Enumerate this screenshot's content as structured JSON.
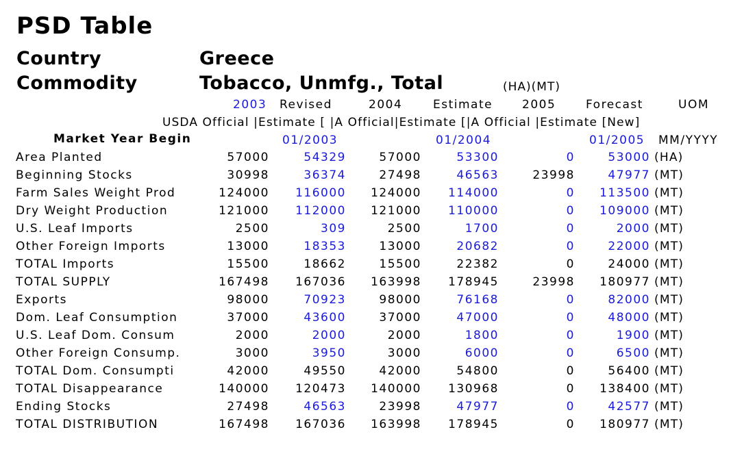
{
  "title": "PSD Table",
  "country_label": "Country",
  "country_value": "Greece",
  "commodity_label": "Commodity",
  "commodity_value": "Tobacco, Unmfg., Total",
  "units_note": "(HA)(MT)",
  "header1": [
    "2003",
    "Revised",
    "2004",
    "Estimate",
    "2005",
    "Forecast",
    "UOM"
  ],
  "header2": "USDA Official |Estimate [ |A Official|Estimate [|A Official |Estimate [New]",
  "market_year_label": "Market Year Begin",
  "market_year_values": [
    "01/2003",
    "01/2004",
    "01/2005"
  ],
  "market_year_uom": "MM/YYYY",
  "rows": [
    {
      "label": "Area Planted",
      "v": [
        "57000",
        "54329",
        "57000",
        "53300",
        "0",
        "53000"
      ],
      "uom": "(HA)"
    },
    {
      "label": "Beginning Stocks",
      "v": [
        "30998",
        "36374",
        "27498",
        "46563",
        "23998",
        "47977"
      ],
      "uom": "(MT)"
    },
    {
      "label": "Farm Sales Weight Prod",
      "v": [
        "124000",
        "116000",
        "124000",
        "114000",
        "0",
        "113500"
      ],
      "uom": "(MT)"
    },
    {
      "label": "Dry Weight Production",
      "v": [
        "121000",
        "112000",
        "121000",
        "110000",
        "0",
        "109000"
      ],
      "uom": "(MT)"
    },
    {
      "label": "U.S. Leaf Imports",
      "v": [
        "2500",
        "309",
        "2500",
        "1700",
        "0",
        "2000"
      ],
      "uom": "(MT)"
    },
    {
      "label": "Other Foreign Imports",
      "v": [
        "13000",
        "18353",
        "13000",
        "20682",
        "0",
        "22000"
      ],
      "uom": "(MT)"
    },
    {
      "label": "TOTAL Imports",
      "v": [
        "15500",
        "18662",
        "15500",
        "22382",
        "0",
        "24000"
      ],
      "uom": "(MT)"
    },
    {
      "label": "TOTAL SUPPLY",
      "v": [
        "167498",
        "167036",
        "163998",
        "178945",
        "23998",
        "180977"
      ],
      "uom": "(MT)"
    },
    {
      "label": "Exports",
      "v": [
        "98000",
        "70923",
        "98000",
        "76168",
        "0",
        "82000"
      ],
      "uom": "(MT)"
    },
    {
      "label": "Dom. Leaf Consumption",
      "v": [
        "37000",
        "43600",
        "37000",
        "47000",
        "0",
        "48000"
      ],
      "uom": "(MT)"
    },
    {
      "label": "U.S. Leaf Dom. Consum",
      "v": [
        "2000",
        "2000",
        "2000",
        "1800",
        "0",
        "1900"
      ],
      "uom": "(MT)"
    },
    {
      "label": "Other Foreign Consump.",
      "v": [
        "3000",
        "3950",
        "3000",
        "6000",
        "0",
        "6500"
      ],
      "uom": "(MT)"
    },
    {
      "label": "TOTAL Dom. Consumpti",
      "v": [
        "42000",
        "49550",
        "42000",
        "54800",
        "0",
        "56400"
      ],
      "uom": "(MT)"
    },
    {
      "label": "TOTAL Disappearance",
      "v": [
        "140000",
        "120473",
        "140000",
        "130968",
        "0",
        "138400"
      ],
      "uom": "(MT)"
    },
    {
      "label": "Ending Stocks",
      "v": [
        "27498",
        "46563",
        "23998",
        "47977",
        "0",
        "42577"
      ],
      "uom": "(MT)"
    },
    {
      "label": "TOTAL DISTRIBUTION",
      "v": [
        "167498",
        "167036",
        "163998",
        "178945",
        "0",
        "180977"
      ],
      "uom": "(MT)"
    }
  ],
  "colors": {
    "text": "#000000",
    "revised_blue": "#1a1adb"
  }
}
